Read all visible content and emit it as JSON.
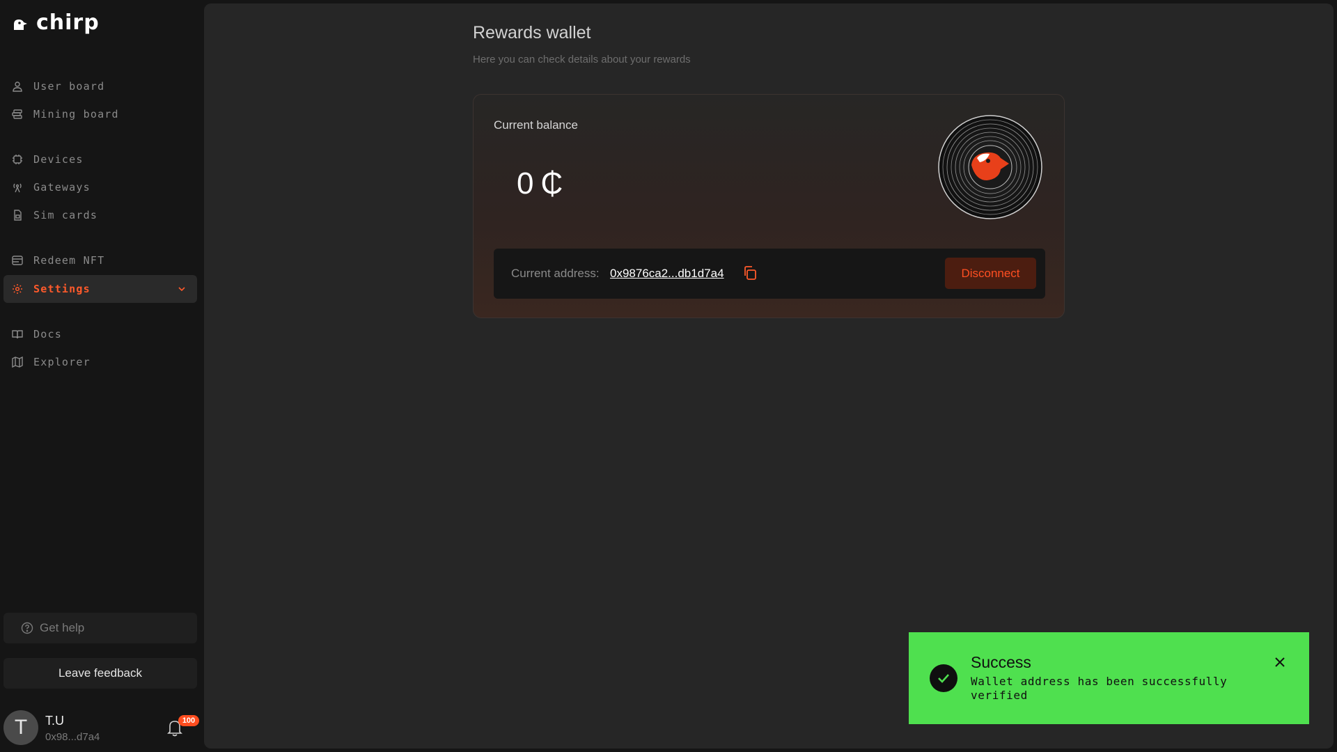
{
  "app": {
    "logo_text": "chirp",
    "logo_icon": "chirp-bird-icon"
  },
  "sidebar": {
    "items": [
      {
        "label": "User board",
        "icon": "user-icon"
      },
      {
        "label": "Mining board",
        "icon": "stack-icon"
      },
      {
        "label": "Devices",
        "icon": "chip-icon"
      },
      {
        "label": "Gateways",
        "icon": "antenna-icon"
      },
      {
        "label": "Sim cards",
        "icon": "sim-card-icon"
      },
      {
        "label": "Redeem NFT",
        "icon": "nft-icon"
      },
      {
        "label": "Settings",
        "icon": "gear-icon",
        "active": true
      },
      {
        "label": "Docs",
        "icon": "book-icon"
      },
      {
        "label": "Explorer",
        "icon": "map-icon"
      }
    ],
    "help_label": "Get help",
    "feedback_label": "Leave feedback",
    "user": {
      "initial": "T",
      "name": "T.U",
      "address": "0x98...d7a4",
      "notification_count": "100"
    }
  },
  "main": {
    "title": "Rewards wallet",
    "subtitle": "Here you can check details about your rewards",
    "card": {
      "balance_label": "Current balance",
      "balance_value": "0",
      "currency_symbol": "₵",
      "address_label": "Current address:",
      "address_value": "0x9876ca2...db1d7a4",
      "disconnect_label": "Disconnect"
    }
  },
  "toast": {
    "title": "Success",
    "message": "Wallet address has been successfully verified",
    "color": "#4fe04f"
  },
  "colors": {
    "accent": "#ff5a2b",
    "background": "#151515",
    "panel": "#262626"
  }
}
